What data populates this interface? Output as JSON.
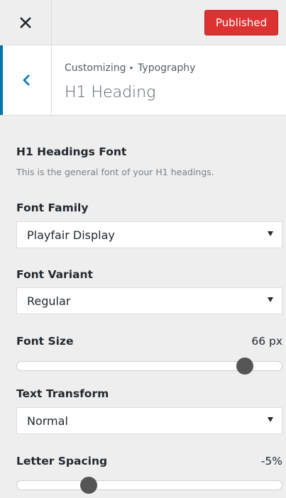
{
  "header": {
    "close_icon": "close-icon",
    "publish_label": "Published",
    "publish_color": "#dc3232"
  },
  "section": {
    "back_icon": "chevron-left-icon",
    "breadcrumb_root": "Customizing",
    "breadcrumb_separator": "▸",
    "breadcrumb_current": "Typography",
    "title": "H1 Heading",
    "accent_color": "#0073aa"
  },
  "group": {
    "title": "H1 Headings Font",
    "description": "This is the general font of your H1 headings."
  },
  "controls": {
    "font_family": {
      "label": "Font Family",
      "value": "Playfair Display"
    },
    "font_variant": {
      "label": "Font Variant",
      "value": "Regular"
    },
    "font_size": {
      "label": "Font Size",
      "readout": "66 px",
      "position_fraction": 0.86
    },
    "text_transform": {
      "label": "Text Transform",
      "value": "Normal"
    },
    "letter_spacing": {
      "label": "Letter Spacing",
      "readout": "-5%",
      "position_fraction": 0.27
    }
  }
}
